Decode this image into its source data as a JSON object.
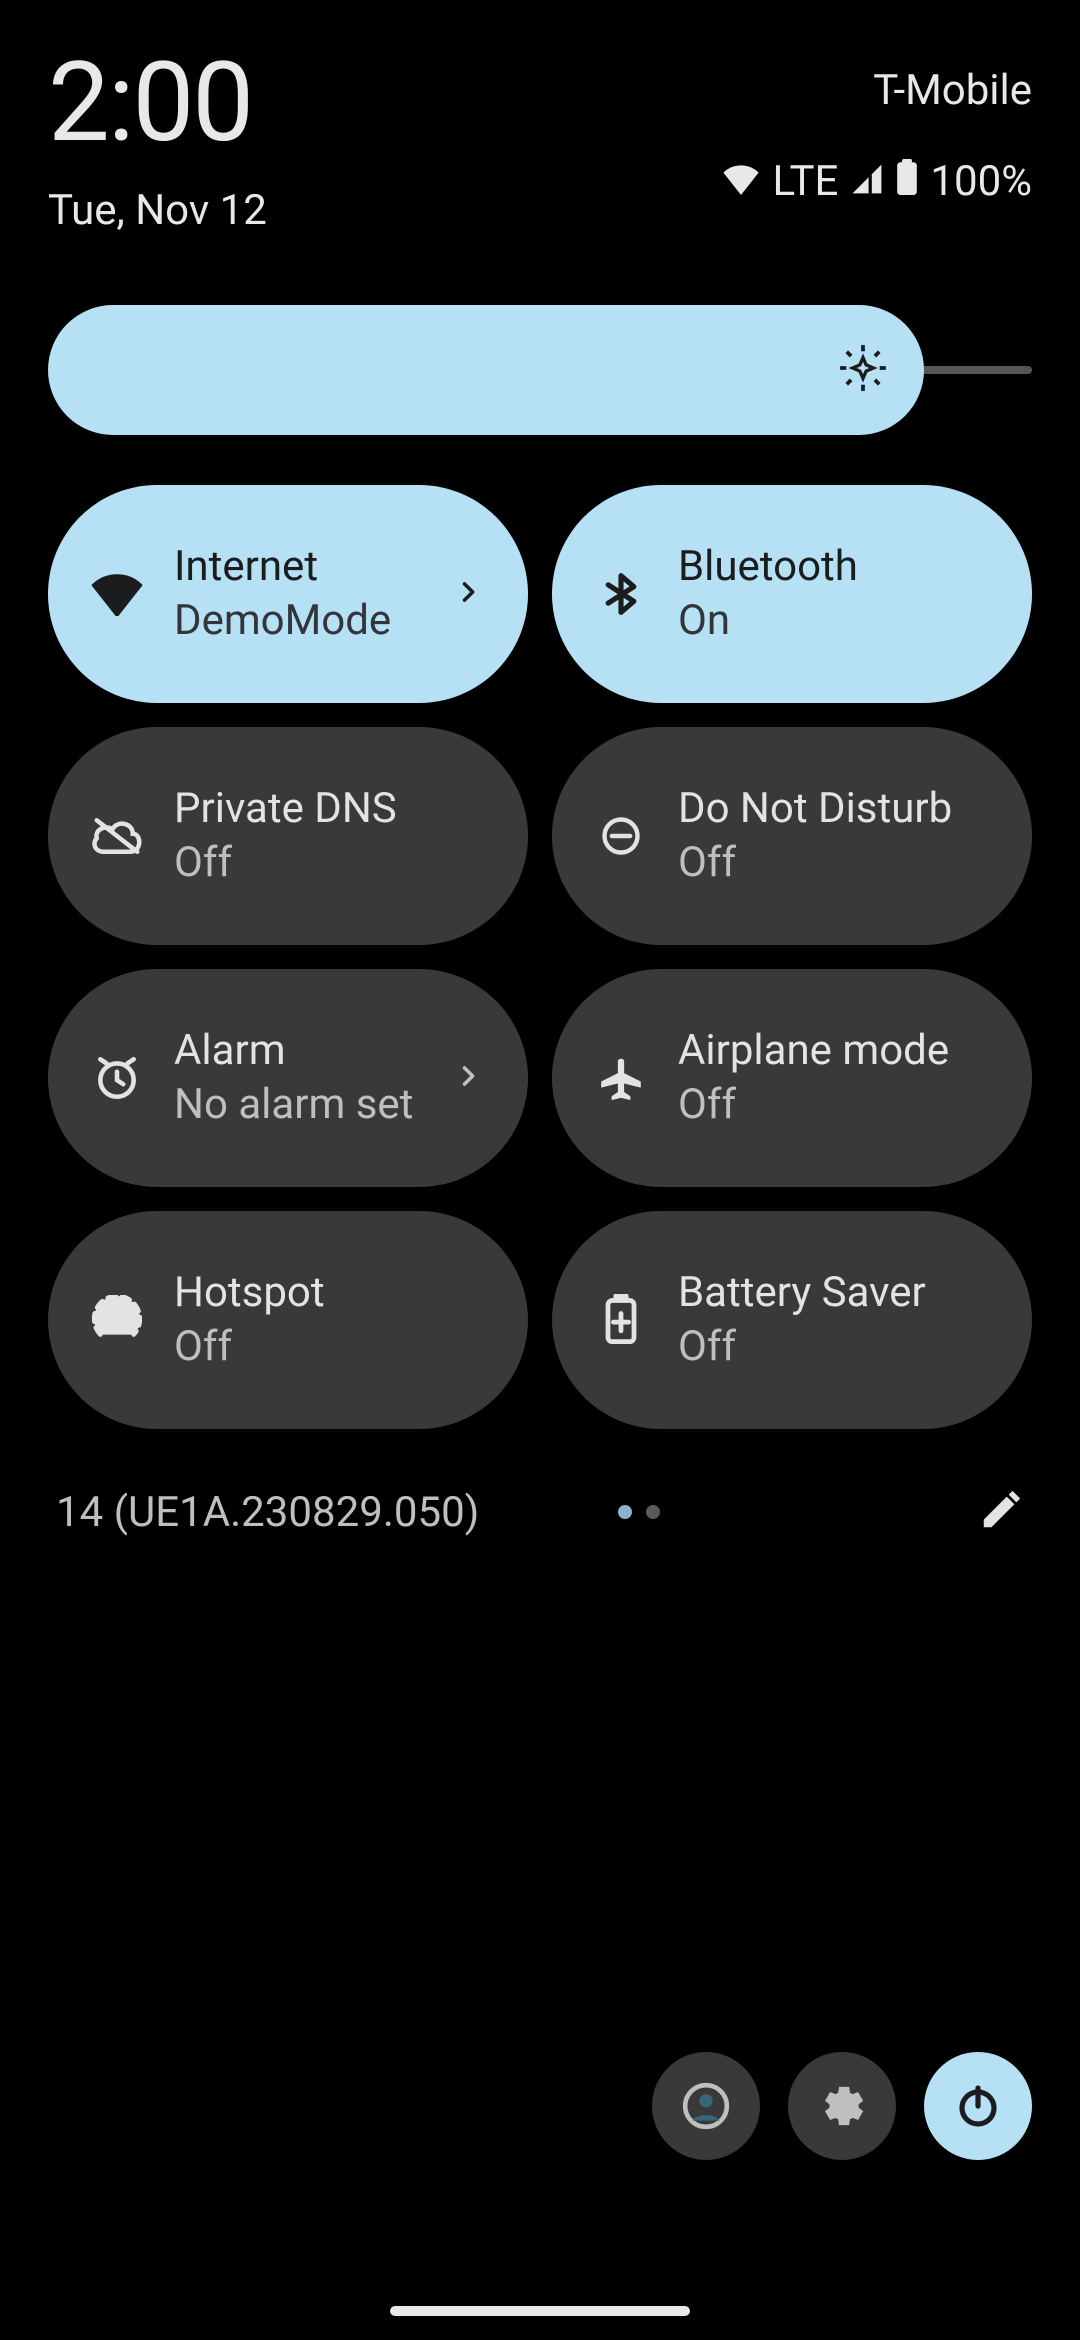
{
  "header": {
    "time": "2:00",
    "date": "Tue, Nov 12",
    "carrier": "T-Mobile",
    "network_type": "LTE",
    "battery_pct": "100%"
  },
  "brightness": {
    "value_pct": 89
  },
  "tiles": [
    {
      "id": "internet",
      "title": "Internet",
      "subtitle": "DemoMode",
      "active": true,
      "has_chevron": true,
      "icon": "wifi"
    },
    {
      "id": "bluetooth",
      "title": "Bluetooth",
      "subtitle": "On",
      "active": true,
      "has_chevron": false,
      "icon": "bluetooth"
    },
    {
      "id": "private-dns",
      "title": "Private DNS",
      "subtitle": "Off",
      "active": false,
      "has_chevron": false,
      "icon": "cloud-off"
    },
    {
      "id": "dnd",
      "title": "Do Not Disturb",
      "subtitle": "Off",
      "active": false,
      "has_chevron": false,
      "icon": "dnd"
    },
    {
      "id": "alarm",
      "title": "Alarm",
      "subtitle": "No alarm set",
      "active": false,
      "has_chevron": true,
      "icon": "alarm"
    },
    {
      "id": "airplane",
      "title": "Airplane mode",
      "subtitle": "Off",
      "active": false,
      "has_chevron": false,
      "icon": "airplane"
    },
    {
      "id": "hotspot",
      "title": "Hotspot",
      "subtitle": "Off",
      "active": false,
      "has_chevron": false,
      "icon": "hotspot"
    },
    {
      "id": "battery-saver",
      "title": "Battery Saver",
      "subtitle": "Off",
      "active": false,
      "has_chevron": false,
      "icon": "battery-saver"
    }
  ],
  "build_info": "14 (UE1A.230829.050)",
  "pages": {
    "count": 2,
    "current": 0
  }
}
